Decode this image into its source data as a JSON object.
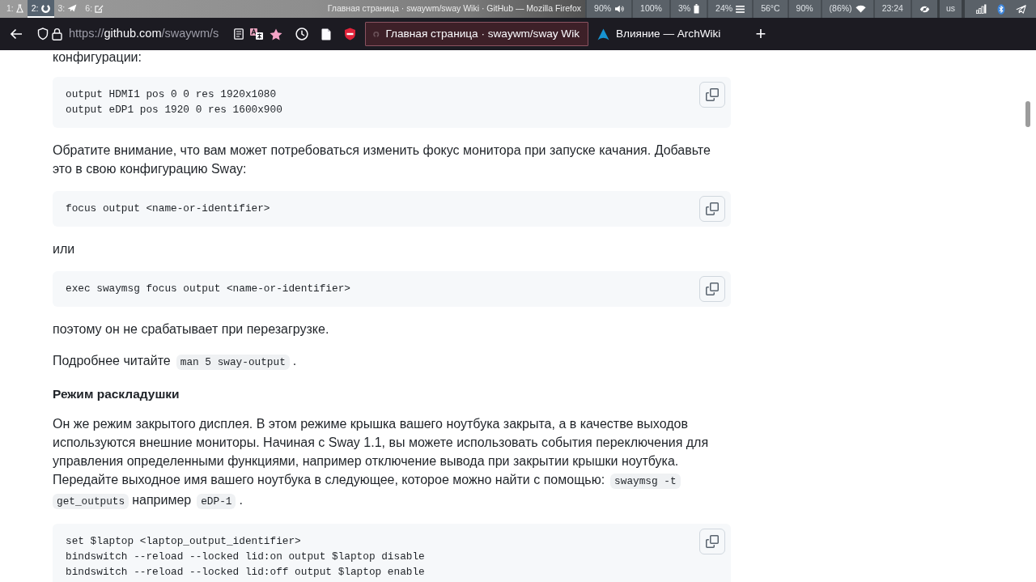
{
  "topbar": {
    "workspaces": [
      {
        "label": "1:",
        "selected": false
      },
      {
        "label": "2:",
        "selected": true
      },
      {
        "label": "3:",
        "selected": false
      },
      {
        "label": "6:",
        "selected": false
      }
    ],
    "window_title": "Главная страница · swaywm/sway Wiki · GitHub — Mozilla Firefox",
    "status": [
      {
        "kind": "speaker",
        "text": "90%"
      },
      {
        "kind": "text",
        "text": "100%"
      },
      {
        "kind": "battery",
        "text": "3%"
      },
      {
        "kind": "lines",
        "text": "24%"
      },
      {
        "kind": "text",
        "text": "56°C"
      },
      {
        "kind": "text",
        "text": "90%"
      },
      {
        "kind": "wifi",
        "text": "(86%)"
      },
      {
        "kind": "text",
        "text": "23:24"
      },
      {
        "kind": "eye"
      }
    ],
    "keyboard_layout": "us"
  },
  "browser": {
    "url": "https://**github.com**/swaywm/s",
    "tabs": [
      {
        "title": "Главная страница · swaywm/sway Wik",
        "selected": true
      },
      {
        "title": "Влияние — ArchWiki",
        "selected": false
      }
    ],
    "new_tab": "+"
  },
  "article": [
    {
      "kind": "paragraph",
      "text": "конфигурации:"
    },
    {
      "kind": "code",
      "lines": [
        "output HDMI1 pos 0 0 res 1920x1080",
        "output eDP1 pos 1920 0 res 1600x900"
      ]
    },
    {
      "kind": "paragraph",
      "text": "Обратите внимание, что вам может потребоваться изменить фокус монитора при запуске качания. Добавьте\nэто в свою конфигурацию Sway:"
    },
    {
      "kind": "code",
      "lines": [
        "focus output <name-or-identifier>"
      ]
    },
    {
      "kind": "paragraph",
      "text": "или"
    },
    {
      "kind": "code",
      "lines": [
        "exec swaymsg focus output <name-or-identifier>"
      ]
    },
    {
      "kind": "paragraph",
      "text": "поэтому он не срабатывает при перезагрузке."
    },
    {
      "kind": "mixed",
      "lines": [
        [
          {
            "kind": "text",
            "text": "Подробнее читайте"
          },
          {
            "kind": "code",
            "text": "man 5 sway-output"
          },
          {
            "kind": "text",
            "text": "."
          }
        ]
      ]
    },
    {
      "kind": "heading",
      "text": "Режим раскладушки"
    },
    {
      "kind": "mixed",
      "lines": [
        [
          {
            "kind": "text",
            "text": "Он же режим закрытого дисплея. В этом режиме крышка вашего ноутбука закрыта, а в качестве выходов\nиспользуются внешние мониторы. Начиная с Sway 1.1, вы можете использовать события переключения для\nуправления определенными функциями, например отключение вывода при закрытии крышки ноутбука."
          }
        ],
        [
          {
            "kind": "text",
            "text": "Передайте выходное имя вашего ноутбука в следующее, которое можно найти с помощью:"
          },
          {
            "kind": "code",
            "text": "swaymsg -t"
          }
        ],
        [
          {
            "kind": "code",
            "text": "get_outputs"
          },
          {
            "kind": "text",
            "text": "например"
          },
          {
            "kind": "code",
            "text": "eDP-1"
          },
          {
            "kind": "text",
            "text": "."
          }
        ]
      ]
    },
    {
      "kind": "code",
      "lines": [
        "set $laptop <laptop_output_identifier>",
        "bindswitch --reload --locked lid:on output $laptop disable",
        "bindswitch --reload --locked lid:off output $laptop enable"
      ]
    }
  ]
}
